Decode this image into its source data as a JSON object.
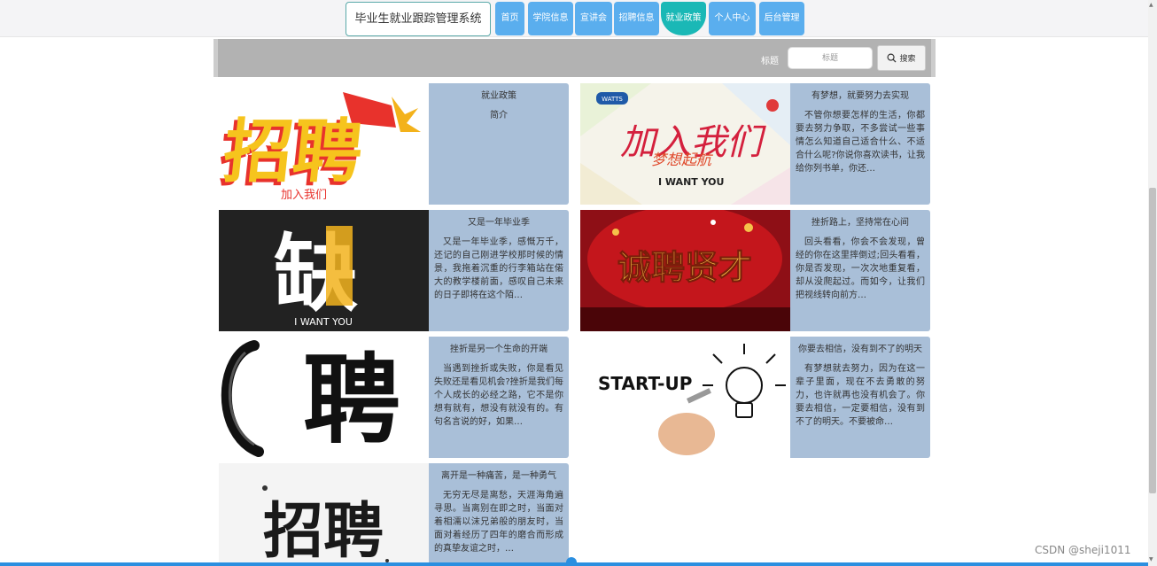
{
  "header": {
    "brand": "毕业生就业跟踪管理系统",
    "nav": [
      {
        "label": "首页"
      },
      {
        "label": "学院信息"
      },
      {
        "label": "宣讲会"
      },
      {
        "label": "招聘信息"
      },
      {
        "label": "就业政策",
        "active": true
      },
      {
        "label": "个人中心"
      },
      {
        "label": "后台管理"
      }
    ]
  },
  "search": {
    "label": "标题",
    "placeholder": "标题",
    "button_label": "搜索"
  },
  "cards": [
    {
      "title": "就业政策",
      "desc": "简介",
      "image_text": "招聘",
      "image_sub": "加入我们"
    },
    {
      "title": "有梦想，就要努力去实现",
      "desc": "不管你想要怎样的生活，你都要去努力争取，不多尝试一些事情怎么知道自己适合什么、不适合什么呢?你说你喜欢读书，让我给你列书单，你还…",
      "image_text": "加入我们",
      "image_sub": "梦想起航",
      "image_caption": "I WANT YOU",
      "image_logo": "WATTS"
    },
    {
      "title": "又是一年毕业季",
      "desc": "又是一年毕业季，感慨万千，还记的自己刚进学校那时候的情景，我拖着沉重的行李箱站在偌大的教学楼前面，感叹自己未来的日子即将在这个陌…",
      "image_text": "缺",
      "image_caption": "I WANT YOU"
    },
    {
      "title": "挫折路上，坚持常在心间",
      "desc": "回头看看，你会不会发现，曾经的你在这里摔倒过;回头看看，你是否发现，一次次地重复看，却从没爬起过。而如今，让我们把视线转向前方…",
      "image_text": "诚聘贤才"
    },
    {
      "title": "挫折是另一个生命的开端",
      "desc": "当遇到挫折或失败，你是看见失败还是看见机会?挫折是我们每个人成长的必经之路，它不是你想有就有，想没有就没有的。有句名言说的好，如果…",
      "image_text": "聘"
    },
    {
      "title": "你要去相信，没有到不了的明天",
      "desc": "有梦想就去努力，因为在这一辈子里面，现在不去勇敢的努力，也许就再也没有机会了。你要去相信，一定要相信，没有到不了的明天。不要被命…",
      "image_text": "START-UP"
    },
    {
      "title": "离开是一种痛苦，是一种勇气",
      "desc": "无穷无尽是离愁，天涯海角遍寻思。当离别在即之时，当面对着相濡以沫兄弟般的朋友时，当面对着经历了四年的磨合而形成的真挚友谊之时，…",
      "image_text": "招聘"
    }
  ],
  "watermark": "CSDN @sheji1011",
  "colors": {
    "nav": "#5aaeee",
    "nav_active": "#1ab8b6",
    "card_info": "#a9bfd8",
    "searchbar": "#b2b2b2"
  }
}
